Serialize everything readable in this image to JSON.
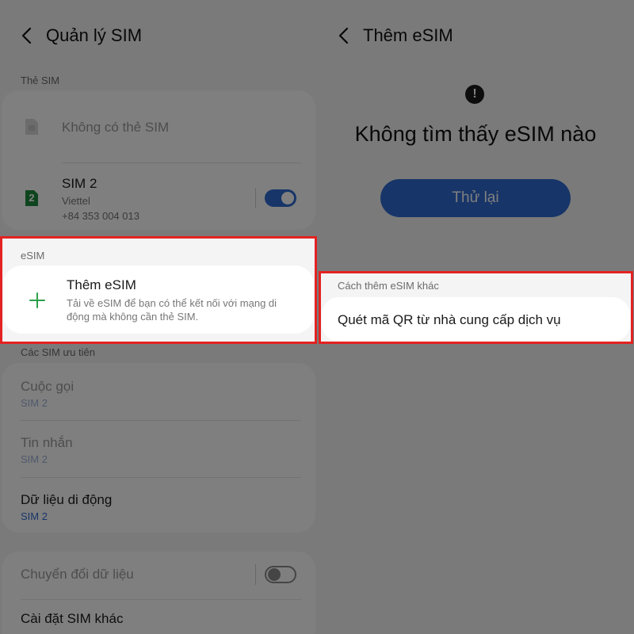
{
  "left": {
    "title": "Quản lý SIM",
    "sim_cards_label": "Thẻ SIM",
    "no_sim": "Không có thẻ SIM",
    "sim2": {
      "badge": "2",
      "name": "SIM 2",
      "carrier": "Viettel",
      "phone": "+84 353 004 013",
      "enabled": true
    },
    "esim_label": "eSIM",
    "add_esim": {
      "title": "Thêm eSIM",
      "desc_line1": "Tải về eSIM để bạn có thể kết nối với mạng di",
      "desc_line2": "động mà không cần thẻ SIM."
    },
    "preferred_label": "Các SIM ưu tiên",
    "preferred": [
      {
        "title": "Cuộc gọi",
        "value": "SIM 2"
      },
      {
        "title": "Tin nhắn",
        "value": "SIM 2"
      },
      {
        "title": "Dữ liệu di động",
        "value": "SIM 2"
      }
    ],
    "data_switch": "Chuyển đổi dữ liệu",
    "data_switch_enabled": false,
    "other_settings": "Cài đặt SIM khác"
  },
  "right": {
    "title": "Thêm eSIM",
    "alert_symbol": "!",
    "message": "Không tìm thấy eSIM nào",
    "retry": "Thử lại",
    "other_ways_label": "Cách thêm eSIM khác",
    "scan_qr": "Quét mã QR từ nhà cung cấp dịch vụ"
  },
  "colors": {
    "accent": "#2f6bd1",
    "highlight_border": "#e32222",
    "plus_green": "#2da04a",
    "sim_badge_green": "#1f8a3c"
  }
}
